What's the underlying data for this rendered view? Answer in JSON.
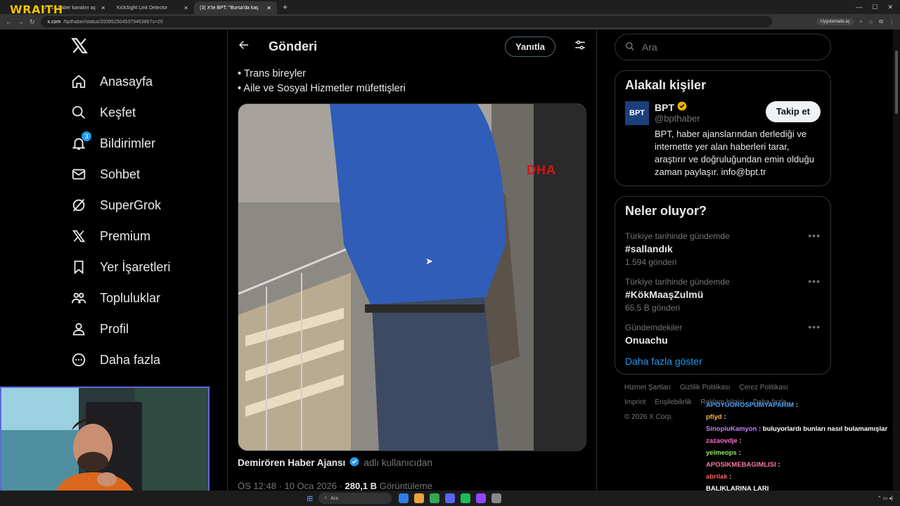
{
  "stream": {
    "brand": "WRAITH"
  },
  "browser": {
    "tabs": [
      {
        "label": "...ı TV - 14 haber kanalını aç",
        "active": false
      },
      {
        "label": "KickSight Link Detector",
        "active": false
      },
      {
        "label": "(3) X'te BPT: \"Bursa'da kaç",
        "active": true
      }
    ],
    "url_domain": "x.com",
    "url_path": "/bpthaber/status/2009925045379463887s=20",
    "app_chip": "Uygulamada aç"
  },
  "nav": {
    "items": [
      {
        "label": "Anasayfa",
        "icon": "home-icon"
      },
      {
        "label": "Keşfet",
        "icon": "search-icon"
      },
      {
        "label": "Bildirimler",
        "icon": "bell-icon",
        "badge": "3"
      },
      {
        "label": "Sohbet",
        "icon": "mail-icon"
      },
      {
        "label": "SuperGrok",
        "icon": "grok-icon"
      },
      {
        "label": "Premium",
        "icon": "x-logo-icon"
      },
      {
        "label": "Yer İşaretleri",
        "icon": "bookmark-icon"
      },
      {
        "label": "Topluluklar",
        "icon": "communities-icon"
      },
      {
        "label": "Profil",
        "icon": "person-icon"
      },
      {
        "label": "Daha fazla",
        "icon": "more-circle-icon"
      }
    ]
  },
  "main": {
    "title": "Gönderi",
    "reply_label": "Yanıtla",
    "bullets": [
      "• Trans bireyler",
      "• Aile ve Sosyal Hizmetler müfettişleri"
    ],
    "media_watermark": "DHA",
    "attribution_name": "Demirören Haber Ajansı",
    "attribution_suffix": "adlı kullanıcıdan",
    "meta_time": "ÖS 12:48 · 10 Oca 2026 ·",
    "meta_views": "280,1 B",
    "meta_views_label": "Görüntüleme"
  },
  "right": {
    "search_placeholder": "Ara",
    "related_title": "Alakalı kişiler",
    "person": {
      "avatar_text": "BPT",
      "name": "BPT",
      "handle": "@bpthaber",
      "follow_label": "Takip et",
      "bio": "BPT, haber ajanslarından derlediği ve internette yer alan haberleri tarar, araştırır ve doğruluğundan emin olduğu zaman paylaşır. info@bpt.tr"
    },
    "trends_title": "Neler oluyor?",
    "trends": [
      {
        "context": "Türkiye tarihinde gündemde",
        "name": "#sallandık",
        "count": "1.594 gönderi"
      },
      {
        "context": "Türkiye tarihinde gündemde",
        "name": "#KökMaaşZulmü",
        "count": "65,5 B gönderi"
      },
      {
        "context": "Gündemdekiler",
        "name": "Onuachu",
        "count": ""
      }
    ],
    "show_more": "Daha fazla göster",
    "footer": [
      "Hizmet Şartları",
      "Gizlilik Politikası",
      "Çerez Politikası",
      "Imprint",
      "Erişilebilirlik",
      "Reklam bilgisi",
      "Daha fazla ...",
      "© 2026 X Corp."
    ]
  },
  "chat": [
    {
      "user": "APOYUOROSPUMYAPARIM",
      "message": ""
    },
    {
      "user": "pflyd",
      "message": ""
    },
    {
      "user": "SinopluKamyon",
      "message": "buluyorlardı bunları nasıl bulamamışlar"
    },
    {
      "user": "zazaovdje",
      "message": ""
    },
    {
      "user": "yelmeops",
      "message": ""
    },
    {
      "user": "APOSIKMEBAGIMLISI",
      "message": ""
    },
    {
      "user": "abrilak",
      "message": ""
    },
    {
      "user": "BALIKLARINA LARI",
      "message": ""
    }
  ],
  "taskbar": {
    "search_placeholder": "Ara"
  },
  "colors": {
    "accent": "#1d9bf0",
    "verified": "#1d9bf0",
    "gold_badge": "#e8b400"
  }
}
